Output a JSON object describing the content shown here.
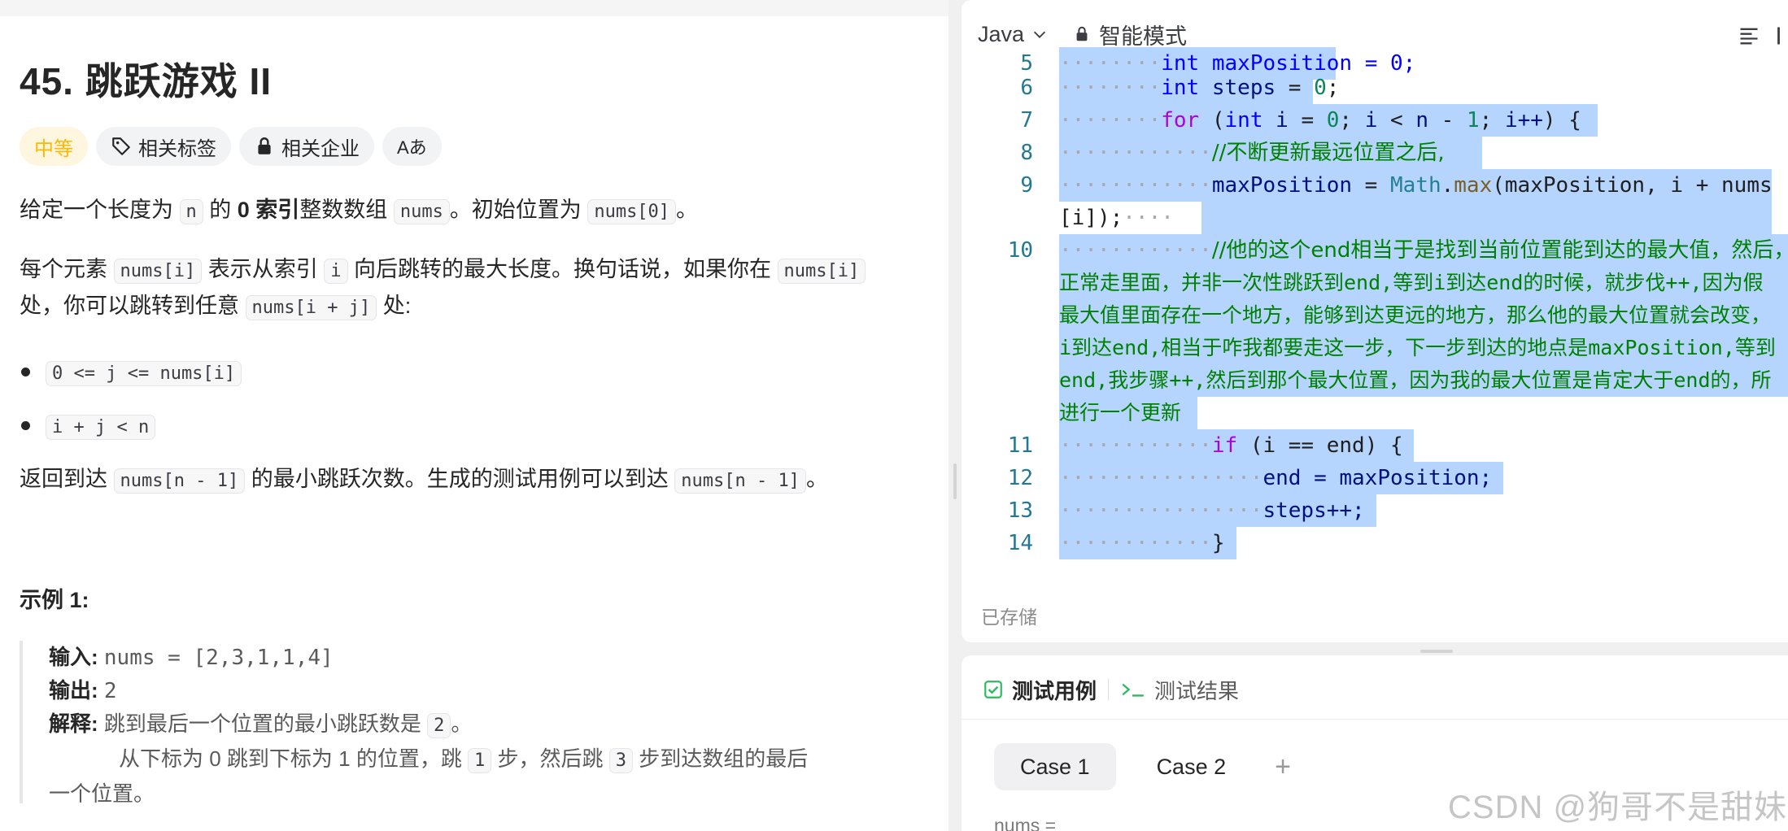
{
  "problem": {
    "title": "45. 跳跃游戏 II",
    "tags": {
      "difficulty": "中等",
      "related_tags": "相关标签",
      "related_companies": "相关企业",
      "translate": "Aあ"
    },
    "p1": {
      "a": "给定一个长度为 ",
      "n": "n",
      "b": " 的 ",
      "bold": "0 索引",
      "c": "整数数组 ",
      "nums": "nums",
      "d": "。初始位置为 ",
      "nums0": "nums[0]",
      "e": "。"
    },
    "p2": {
      "a": "每个元素 ",
      "numsi": "nums[i]",
      "b": " 表示从索引 ",
      "i": "i",
      "c": " 向后跳转的最大长度。换句话说，如果你在 ",
      "numsi2": "nums[i]",
      "d": " 处，你可以跳转到任意 ",
      "numsij": "nums[i + j]",
      "e": " 处:"
    },
    "bullets": [
      "0 <= j <= nums[i]",
      "i + j < n"
    ],
    "p3": {
      "a": "返回到达 ",
      "code1": "nums[n - 1]",
      "b": " 的最小跳跃次数。生成的测试用例可以到达 ",
      "code2": "nums[n - 1]",
      "c": "。"
    },
    "example": {
      "title": "示例 1:",
      "input_label": "输入:",
      "input_value": "nums = [2,3,1,1,4]",
      "output_label": "输出:",
      "output_value": "2",
      "explain_label": "解释:",
      "explain_a": "跳到最后一个位置的最小跳跃数是 ",
      "explain_code": "2",
      "explain_b": "。",
      "line2_a": "从下标为 0 跳到下标为 1 的位置，跳 ",
      "line2_code1": "1",
      "line2_b": " 步，然后跳 ",
      "line2_code2": "3",
      "line2_c": " 步到达数组的最后",
      "line3": "一个位置。"
    }
  },
  "editor": {
    "language": "Java",
    "mode": "智能模式",
    "saved": "已存储",
    "line_numbers": [
      "5",
      "6",
      "7",
      "8",
      "9",
      "10",
      "11",
      "12",
      "13",
      "14"
    ],
    "code": {
      "l5": "int maxPosition = 0;",
      "l6_kw": "int",
      "l6_var": "steps",
      "l6_num": "0",
      "l7_for": "for",
      "l7_int": "int",
      "l7_i": "i",
      "l7_zero": "0",
      "l7_i2": "i",
      "l7_n": "n",
      "l7_one": "1",
      "l7_inc": "i++",
      "l8": "//不断更新最远位置之后,",
      "l9_var": "maxPosition",
      "l9_cls": "Math",
      "l9_fn": "max",
      "l9_args": "(maxPosition, i + nums",
      "l9_wrap": "[i]);",
      "l10": [
        "//他的这个end相当于是找到当前位置能到达的最大值，然后，",
        "正常走里面，并非一次性跳跃到end,等到i到达end的时候，就步伐++,因为假",
        "最大值里面存在一个地方，能够到达更远的地方，那么他的最大位置就会改变，",
        "i到达end,相当于咋我都要走这一步，下一步到达的地点是maxPosition,等到",
        "end,我步骤++,然后到那个最大位置，因为我的最大位置是肯定大于end的，所",
        "进行一个更新"
      ],
      "l11_if": "if",
      "l11_rest": "(i == end) {",
      "l12": "end = maxPosition;",
      "l13": "steps++;",
      "l14": "}"
    }
  },
  "test_panel": {
    "tab_cases": "测试用例",
    "tab_results": "测试结果",
    "cases": [
      "Case 1",
      "Case 2"
    ],
    "add": "+",
    "nums_label": "nums ="
  },
  "watermark": "CSDN @狗哥不是甜妹",
  "icons": {
    "tag": "tag-icon",
    "lock": "lock-icon",
    "translate": "translate-icon",
    "chevron": "chevron-down-icon",
    "checkbox": "checkbox-icon",
    "terminal": "terminal-icon",
    "format": "format-icon"
  }
}
